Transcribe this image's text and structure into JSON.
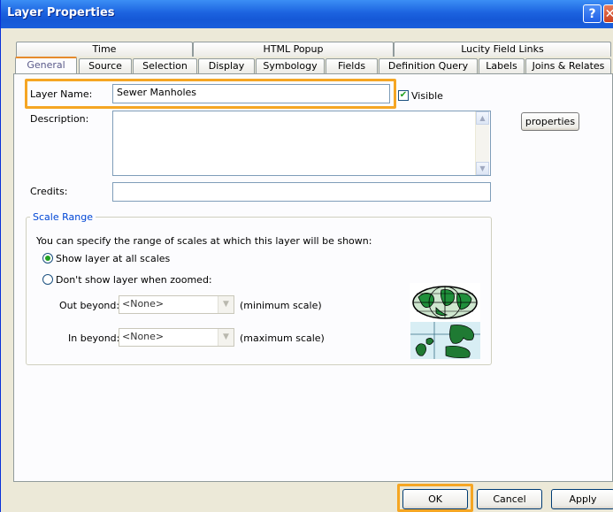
{
  "window": {
    "title": "Layer Properties",
    "help_glyph": "?",
    "close_glyph": "✕"
  },
  "tabs_row1": [
    "Time",
    "HTML Popup",
    "Lucity Field Links"
  ],
  "tabs_row2": [
    "General",
    "Source",
    "Selection",
    "Display",
    "Symbology",
    "Fields",
    "Definition Query",
    "Labels",
    "Joins & Relates"
  ],
  "active_tab": "General",
  "general": {
    "layer_name_label": "Layer Name:",
    "layer_name_value": "Sewer Manholes",
    "visible_label": "Visible",
    "visible_checked": true,
    "visible_check_glyph": "✔",
    "description_label": "Description:",
    "description_value": "",
    "credits_label": "Credits:",
    "credits_value": "",
    "properties_button": "properties",
    "scale_range": {
      "title": "Scale Range",
      "intro": "You can specify the range of scales at which this layer will be shown:",
      "option_all": "Show layer at all scales",
      "option_zoomed": "Don't show layer when zoomed:",
      "selected_option": "all",
      "out_beyond_label": "Out beyond:",
      "out_beyond_value": "<None>",
      "out_beyond_hint": "(minimum scale)",
      "in_beyond_label": "In beyond:",
      "in_beyond_value": "<None>",
      "in_beyond_hint": "(maximum scale)"
    }
  },
  "buttons": {
    "ok": "OK",
    "cancel": "Cancel",
    "apply": "Apply"
  },
  "highlight_color": "#f5a623"
}
